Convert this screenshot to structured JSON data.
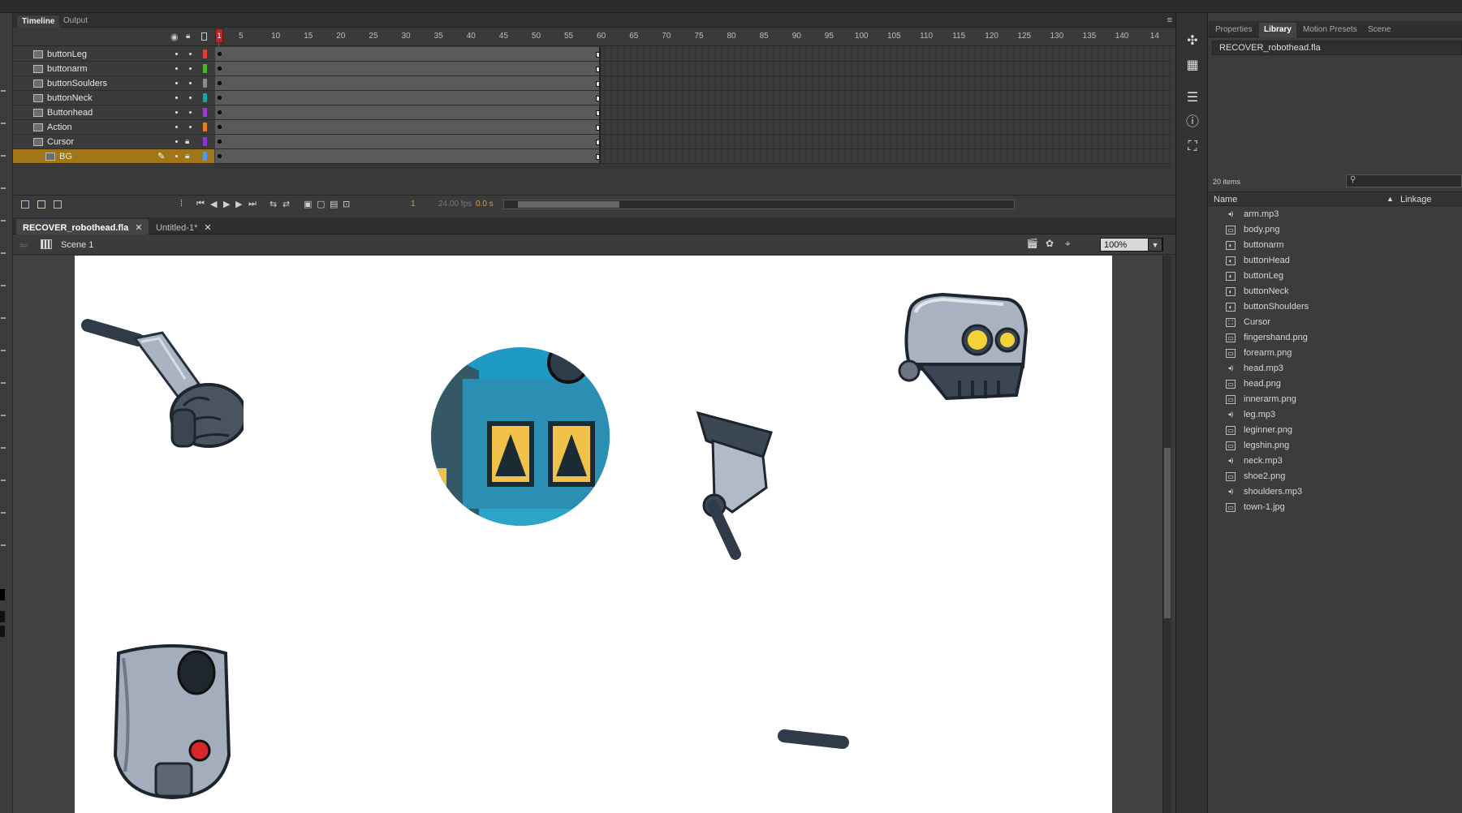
{
  "timeline": {
    "tabs": [
      "Timeline",
      "Output"
    ],
    "ruler_labels": [
      "5",
      "10",
      "15",
      "20",
      "25",
      "30",
      "35",
      "40",
      "45",
      "50",
      "55",
      "60",
      "65",
      "70",
      "75",
      "80",
      "85",
      "90",
      "95",
      "100",
      "105",
      "110",
      "115",
      "120",
      "125",
      "130",
      "135",
      "140",
      "14"
    ],
    "playhead_frame": "1",
    "layers": [
      {
        "name": "buttonLeg",
        "color": "#e23b3b"
      },
      {
        "name": "buttonarm",
        "color": "#4fb62b"
      },
      {
        "name": "buttonSoulders",
        "color": "#8a8a8a"
      },
      {
        "name": "buttonNeck",
        "color": "#1aa3a3"
      },
      {
        "name": "Buttonhead",
        "color": "#9a3ad1"
      },
      {
        "name": "Action",
        "color": "#e87e1a"
      },
      {
        "name": "Cursor",
        "color": "#8c37c9"
      },
      {
        "name": "BG",
        "color": "#4da0e8"
      }
    ],
    "footer": {
      "frame": "1",
      "fps": "24.00 fps",
      "time": "0.0 s"
    }
  },
  "document": {
    "tabs": [
      {
        "label": "RECOVER_robothead.fla",
        "active": true
      },
      {
        "label": "Untitled-1*",
        "active": false
      }
    ],
    "scene": "Scene 1",
    "zoom": "100%"
  },
  "right_panel": {
    "tabs": [
      "Properties",
      "Library",
      "Motion Presets",
      "Scene"
    ],
    "active_tab": "Library",
    "library_document": "RECOVER_robothead.fla",
    "item_count": "20 items",
    "columns": [
      "Name",
      "Linkage"
    ],
    "items": [
      {
        "name": "arm.mp3",
        "type": "sound"
      },
      {
        "name": "body.png",
        "type": "bitmap"
      },
      {
        "name": "buttonarm",
        "type": "button"
      },
      {
        "name": "buttonHead",
        "type": "button"
      },
      {
        "name": "buttonLeg",
        "type": "button"
      },
      {
        "name": "buttonNeck",
        "type": "button"
      },
      {
        "name": "buttonShoulders",
        "type": "button"
      },
      {
        "name": "Cursor",
        "type": "movieclip"
      },
      {
        "name": "fingershand.png",
        "type": "bitmap"
      },
      {
        "name": "forearm.png",
        "type": "bitmap"
      },
      {
        "name": "head.mp3",
        "type": "sound"
      },
      {
        "name": "head.png",
        "type": "bitmap"
      },
      {
        "name": "innerarm.png",
        "type": "bitmap"
      },
      {
        "name": "leg.mp3",
        "type": "sound"
      },
      {
        "name": "leginner.png",
        "type": "bitmap"
      },
      {
        "name": "legshin.png",
        "type": "bitmap"
      },
      {
        "name": "neck.mp3",
        "type": "sound"
      },
      {
        "name": "shoe2.png",
        "type": "bitmap"
      },
      {
        "name": "shoulders.mp3",
        "type": "sound"
      },
      {
        "name": "town-1.jpg",
        "type": "bitmap"
      }
    ]
  },
  "colors": {
    "selected_layer": "#a07619",
    "playhead": "#b5262b",
    "stage": "#ffffff"
  }
}
